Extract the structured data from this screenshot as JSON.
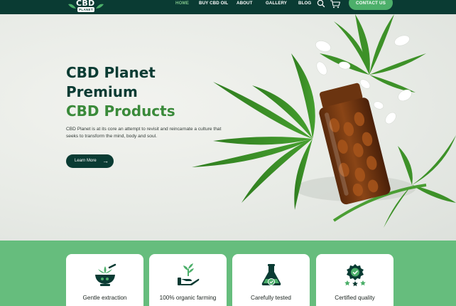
{
  "header": {
    "logo_text": "CBD",
    "logo_sub": "PLANET",
    "nav": [
      {
        "label": "HOME",
        "active": true
      },
      {
        "label": "BUY CBD OIL",
        "active": false
      },
      {
        "label": "ABOUT",
        "active": false
      },
      {
        "label": "GALLERY",
        "active": false
      },
      {
        "label": "BLOG",
        "active": false
      }
    ],
    "search_icon": "search-icon",
    "cart_icon": "cart-icon",
    "contact_label": "CONTACT US"
  },
  "hero": {
    "title_line1": "CBD Planet",
    "title_line2": "Premium",
    "title_line3": "CBD Products",
    "description": "CBD Planet is at its core an attempt to revisit and reincarnate a culture that seeks to transform the mind, body and soul.",
    "cta_label": "Learn More",
    "cta_icon": "arrow-right-icon"
  },
  "features": [
    {
      "label": "Gentle extraction",
      "icon": "mortar-pestle-icon"
    },
    {
      "label": "100% organic farming",
      "icon": "hand-plant-icon"
    },
    {
      "label": "Carefully tested",
      "icon": "flask-check-icon"
    },
    {
      "label": "Certified quality",
      "icon": "award-badge-icon"
    }
  ],
  "colors": {
    "dark_green": "#0a3b33",
    "accent_green": "#4caf6a",
    "band_green": "#66bd7d",
    "title_green": "#3a8a3a"
  }
}
